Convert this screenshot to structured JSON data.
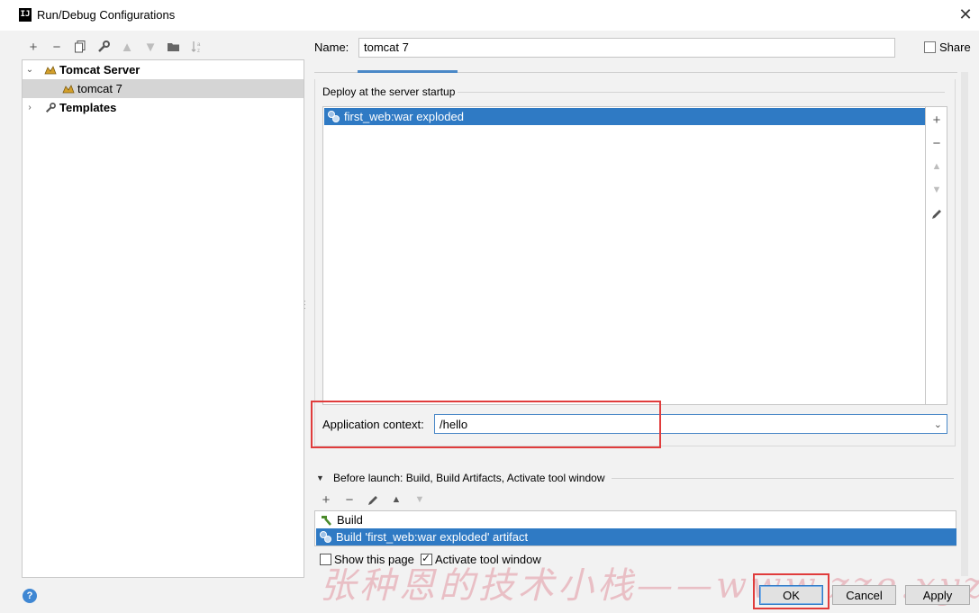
{
  "window": {
    "title": "Run/Debug Configurations",
    "app_icon_text": "IJ"
  },
  "toolbar": {
    "icons": [
      "add-icon",
      "remove-icon",
      "copy-icon",
      "wrench-icon",
      "move-up-icon",
      "move-down-icon",
      "folder-icon",
      "sort-icon"
    ]
  },
  "tree": {
    "group": "Tomcat Server",
    "child": "tomcat 7",
    "templates": "Templates"
  },
  "config": {
    "name_label": "Name:",
    "name_value": "tomcat 7",
    "share_label": "Share"
  },
  "deploy": {
    "title": "Deploy at the server startup",
    "items": [
      "first_web:war exploded"
    ]
  },
  "context": {
    "label": "Application context:",
    "value": "/hello"
  },
  "before_launch": {
    "title": "Before launch: Build, Build Artifacts, Activate tool window",
    "items": [
      "Build",
      "Build 'first_web:war exploded' artifact"
    ]
  },
  "options": {
    "show_page_label": "Show this page",
    "show_page_checked": false,
    "activate_label": "Activate tool window",
    "activate_checked": true
  },
  "buttons": {
    "ok": "OK",
    "cancel": "Cancel",
    "apply": "Apply"
  },
  "help_label": "?",
  "watermark": "张种恩的技术小栈——www.zze.xyz",
  "colors": {
    "selection": "#2f7ac4",
    "highlight_box": "#e03c3c",
    "focus": "#4a88c7"
  }
}
